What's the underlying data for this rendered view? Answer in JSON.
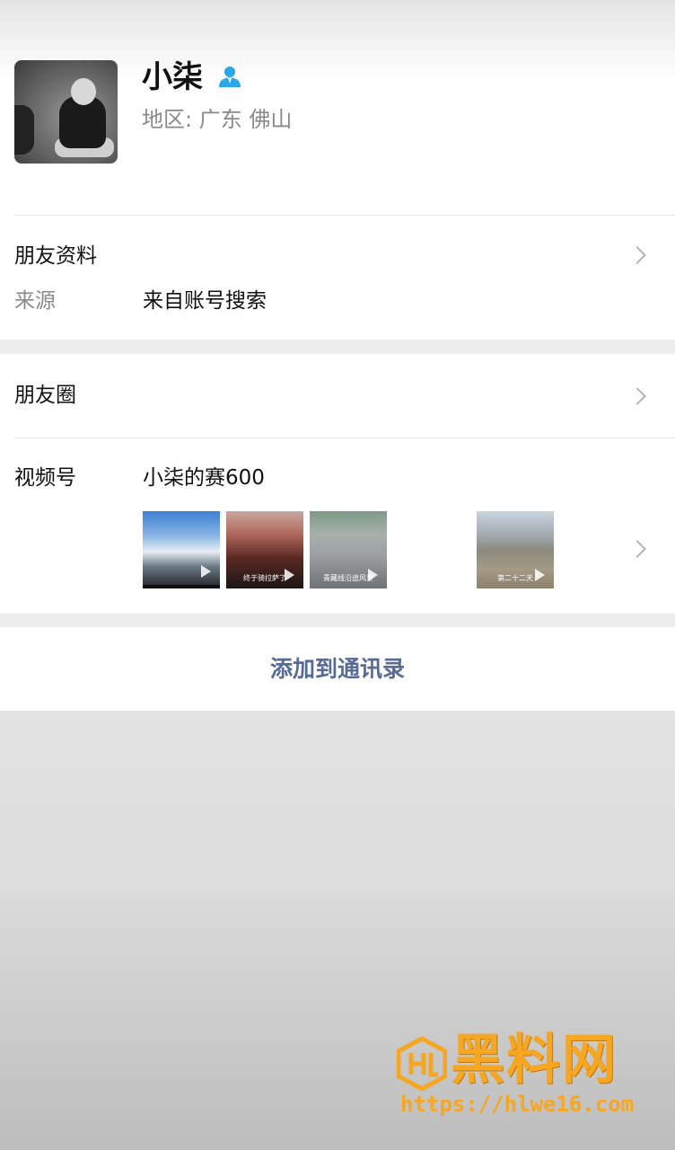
{
  "profile": {
    "name": "小柒",
    "region": "地区: 广东 佛山"
  },
  "friend_info": {
    "title": "朋友资料",
    "source_label": "来源",
    "source_value": "来自账号搜索"
  },
  "moments": {
    "title": "朋友圈"
  },
  "channels": {
    "label": "视频号",
    "value": "小柒的赛600",
    "thumbnails": [
      {
        "caption": ""
      },
      {
        "caption": "终于骑拉萨了"
      },
      {
        "caption": "青藏线沿途风景"
      },
      {
        "caption": "第二十二天"
      }
    ]
  },
  "actions": {
    "add_contact": "添加到通讯录"
  },
  "watermark": {
    "brand": "黑料网",
    "url": "https://hlwe16.com"
  },
  "colors": {
    "link_blue": "#576b95",
    "icon_blue": "#2aa7e6",
    "watermark_orange": "#f5a623"
  }
}
